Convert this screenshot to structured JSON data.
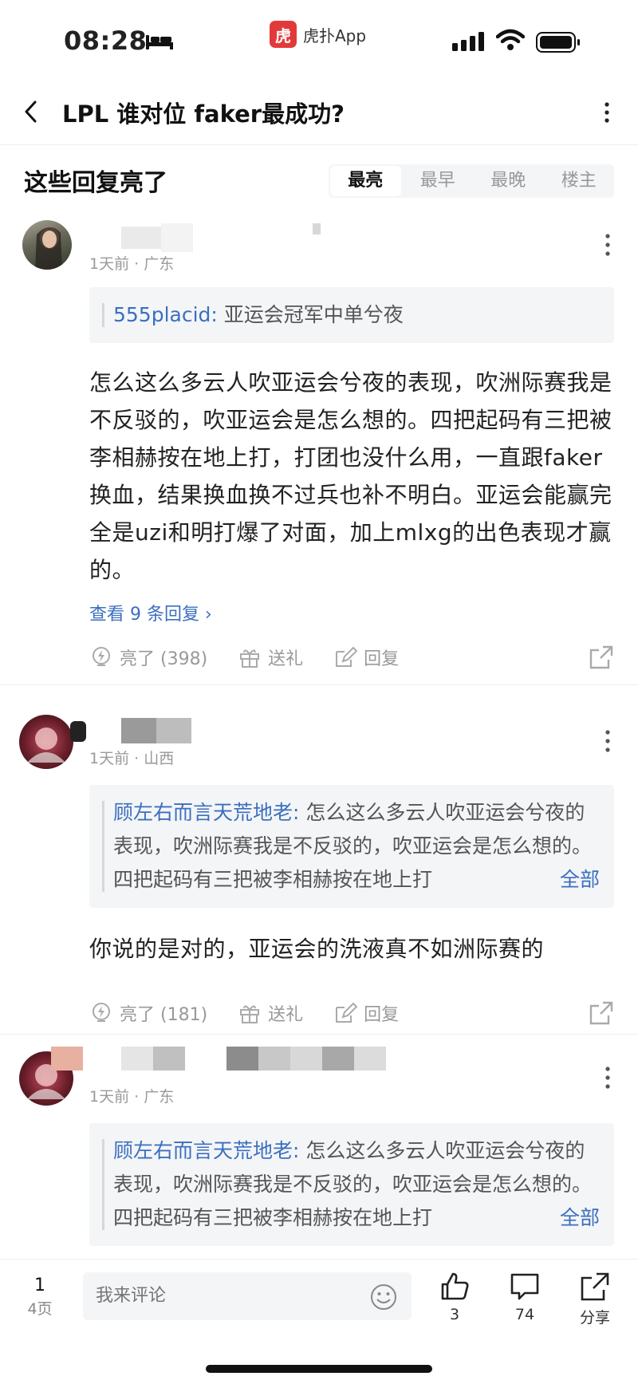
{
  "status_bar": {
    "time": "08:28",
    "app_logo_text": "虎",
    "app_name": "虎扑App"
  },
  "nav": {
    "title": "LPL 谁对位 faker最成功?"
  },
  "section": {
    "title": "这些回复亮了",
    "sort_tabs": [
      "最亮",
      "最早",
      "最晚",
      "楼主"
    ],
    "active_sort": "最亮"
  },
  "comments": [
    {
      "meta": "1天前 · 广东",
      "quote_name": "555placid:",
      "quote_text": " 亚运会冠军中单兮夜",
      "body": "怎么这么多云人吹亚运会兮夜的表现，吹洲际赛我是不反驳的，吹亚运会是怎么想的。四把起码有三把被李相赫按在地上打，打团也没什么用，一直跟faker换血，结果换血换不过兵也补不明白。亚运会能赢完全是uzi和明打爆了对面，加上mlxg的出色表现才赢的。",
      "view_replies": "查看 9 条回复 ›",
      "like": "亮了 (398)",
      "gift": "送礼",
      "reply": "回复"
    },
    {
      "meta": "1天前 · 山西",
      "quote_name": "顾左右而言天荒地老:",
      "quote_text": " 怎么这么多云人吹亚运会兮夜的表现，吹洲际赛我是不反驳的，吹亚运会是怎么想的。四把起码有三把被李相赫按在地上打",
      "quote_all": "全部",
      "body": "你说的是对的，亚运会的洗液真不如洲际赛的",
      "like": "亮了 (181)",
      "gift": "送礼",
      "reply": "回复"
    },
    {
      "meta": "1天前 · 广东",
      "quote_name": "顾左右而言天荒地老:",
      "quote_text": " 怎么这么多云人吹亚运会兮夜的表现，吹洲际赛我是不反驳的，吹亚运会是怎么想的。四把起码有三把被李相赫按在地上打",
      "quote_all": "全部"
    }
  ],
  "bottom_bar": {
    "page_current": "1",
    "page_total": "4页",
    "comment_placeholder": "我来评论",
    "like_count": "3",
    "comment_count": "74",
    "share_label": "分享"
  },
  "colors": {
    "link": "#3b6fbf",
    "brand": "#e23a3a",
    "muted": "#999999"
  }
}
